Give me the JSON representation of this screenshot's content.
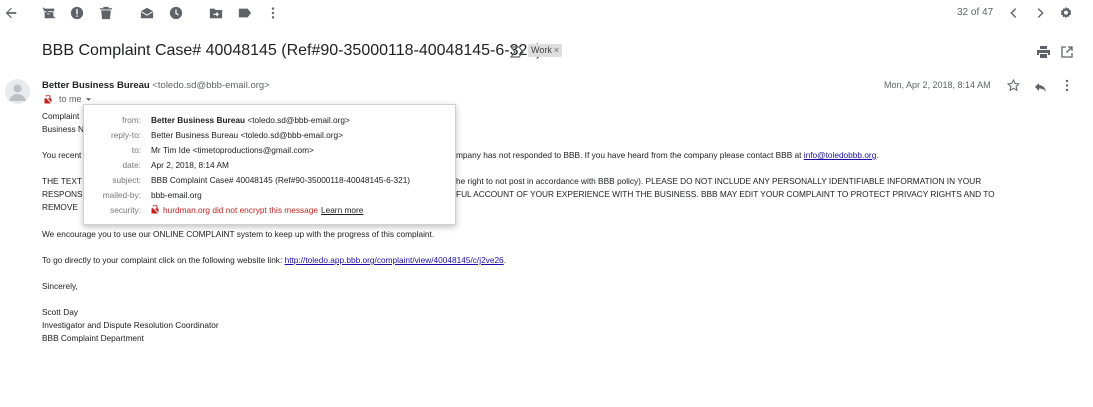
{
  "toolbar": {
    "icons": [
      "back-arrow-icon",
      "archive-icon",
      "report-spam-icon",
      "delete-icon",
      "mark-unread-icon",
      "snooze-icon",
      "move-to-icon",
      "labels-icon",
      "more-vert-icon"
    ],
    "pager": "32 of 47"
  },
  "email": {
    "subject": "BBB Complaint Case# 40048145 (Ref#90-35000118-40048145-6-321)",
    "label": "Work",
    "label_close": "×",
    "sender_name": "Better Business Bureau",
    "sender_address": "<toledo.sd@bbb-email.org>",
    "to": "to me",
    "date": "Mon, Apr 2, 2018, 8:14 AM"
  },
  "details": {
    "from_label": "from:",
    "from_name": "Better Business Bureau",
    "from_address": "<toledo.sd@bbb-email.org>",
    "replyto_label": "reply-to:",
    "replyto_value": "Better Business Bureau <toledo.sd@bbb-email.org>",
    "to_label": "to:",
    "to_value": "Mr Tim Ide <timetoproductions@gmail.com>",
    "date_label": "date:",
    "date_value": "Apr 2, 2018, 8:14 AM",
    "subject_label": "subject:",
    "subject_value": "BBB Complaint Case# 40048145 (Ref#90-35000118-40048145-6-321)",
    "mailedby_label": "mailed-by:",
    "mailedby_value": "bbb-email.org",
    "security_label": "security:",
    "security_value": "hurdman.org did not encrypt this message",
    "learn_more": "Learn more"
  },
  "body": {
    "line1": "Complaint",
    "line2": "Business N",
    "line3_visible": "You recent",
    "line3_right": "mpany has not responded to BBB. If you have heard from the company please contact BBB at",
    "line3_link": "info@toledobbb.org",
    "line3_end": ".",
    "line4_left": "THE TEXT",
    "line4_right": "he right to not post in accordance with BBB policy). PLEASE DO NOT INCLUDE ANY PERSONALLY IDENTIFIABLE INFORMATION IN YOUR",
    "line5_left": "RESPONS",
    "line5_right": "FUL ACCOUNT OF YOUR EXPERIENCE WITH THE BUSINESS. BBB MAY EDIT YOUR COMPLAINT TO PROTECT PRIVACY RIGHTS AND TO",
    "line6_left": "REMOVE",
    "encourage": "We encourage you to use our ONLINE COMPLAINT system to keep up with the progress of this complaint.",
    "direct_text": "To go directly to your complaint click on the following website link:",
    "direct_link": "http://toledo.app.bbb.org/complaint/view/40048145/c/j2ve26",
    "direct_end": ".",
    "sincerely": "Sincerely,",
    "sig_name": "Scott Day",
    "sig_title": "Investigator and Dispute Resolution Coordinator",
    "sig_dept": "BBB Complaint Department"
  },
  "colors": {
    "link": "#1a0dab",
    "security_warning": "#c5221f",
    "icon": "#5f6368"
  }
}
